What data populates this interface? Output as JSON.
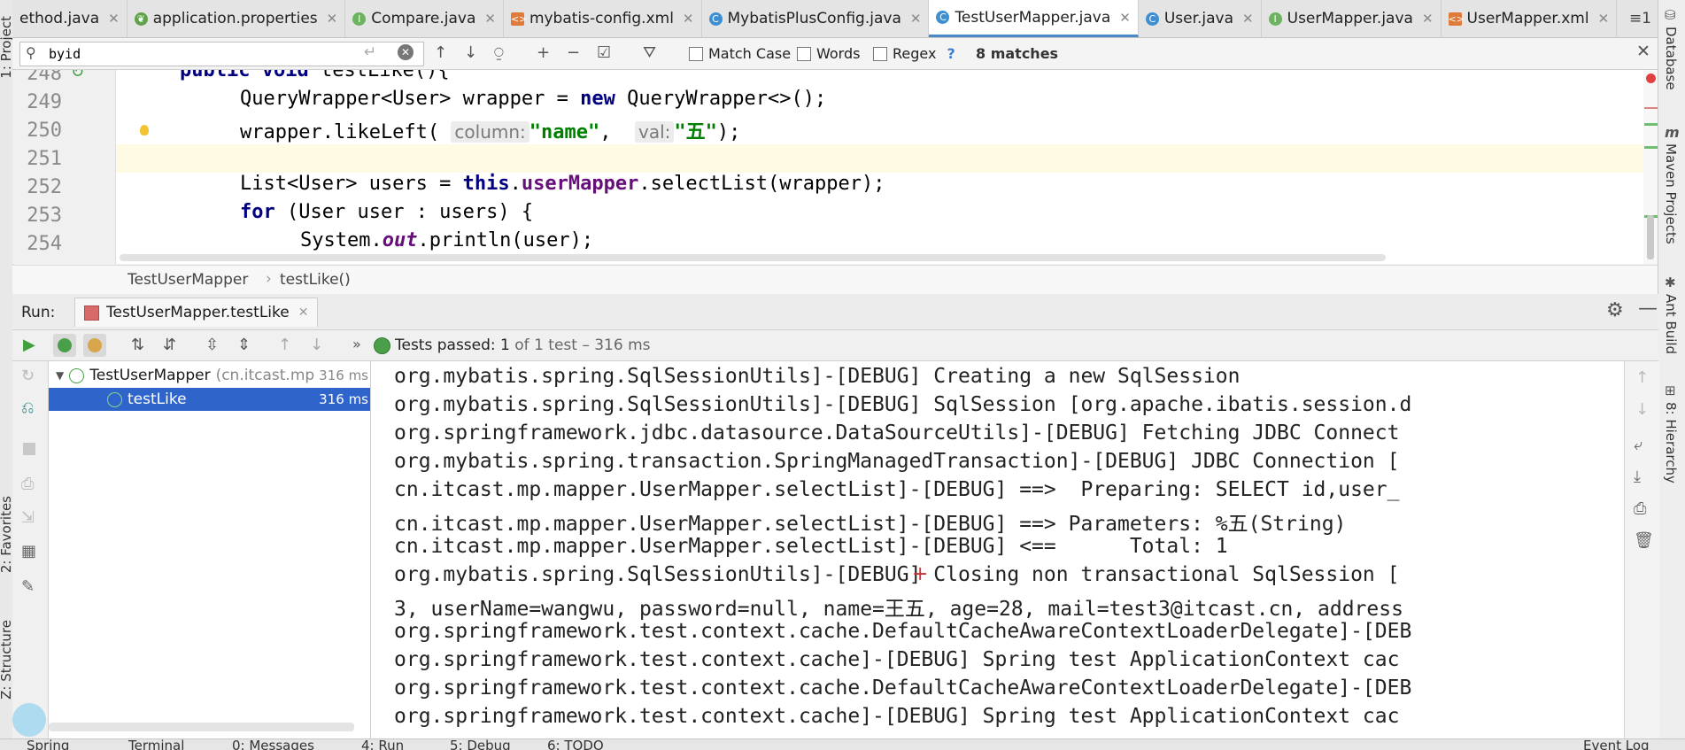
{
  "tabs": [
    {
      "label": "ethod.java",
      "icon": "java-class-icon",
      "active": false
    },
    {
      "label": "application.properties",
      "icon": "spring-leaf-icon",
      "active": false
    },
    {
      "label": "Compare.java",
      "icon": "interface-icon",
      "active": false
    },
    {
      "label": "mybatis-config.xml",
      "icon": "xml-file-icon",
      "active": false
    },
    {
      "label": "MybatisPlusConfig.java",
      "icon": "java-class-icon",
      "active": false
    },
    {
      "label": "TestUserMapper.java",
      "icon": "java-class-icon",
      "active": true
    },
    {
      "label": "User.java",
      "icon": "java-class-icon",
      "active": false
    },
    {
      "label": "UserMapper.java",
      "icon": "interface-icon",
      "active": false
    },
    {
      "label": "UserMapper.xml",
      "icon": "xml-file-icon",
      "active": false
    }
  ],
  "tab_overflow": "≡1",
  "find": {
    "query": "byid",
    "match_case": "Match Case",
    "words": "Words",
    "regex": "Regex",
    "help": "?",
    "matches": "8 matches"
  },
  "editor": {
    "line_numbers": [
      "248",
      "249",
      "250",
      "251",
      "252",
      "253",
      "254"
    ],
    "l248": {
      "a": "public",
      "b": " ",
      "c": "void",
      "d": " testLike(){"
    },
    "l249": {
      "a": "QueryWrapper<User> wrapper = ",
      "b": "new",
      "c": " QueryWrapper<>();"
    },
    "l250": {
      "a": "wrapper.likeLeft( ",
      "hint1": "column:",
      "s1": "\"name\"",
      "c": ",  ",
      "hint2": "val:",
      "s2": "\"五\"",
      "d": ");"
    },
    "l252": {
      "a": "List<User> users = ",
      "b": "this",
      "c": ".",
      "d": "userMapper",
      "e": ".selectList(wrapper);"
    },
    "l253": {
      "a": "for",
      "b": " (User user : users) {"
    },
    "l254": {
      "a": "System.",
      "b": "out",
      "c": ".println(user);"
    }
  },
  "breadcrumb": {
    "class": "TestUserMapper",
    "method": "testLike()"
  },
  "run": {
    "label": "Run:",
    "tab": "TestUserMapper.testLike",
    "status_prefix": "Tests passed:",
    "status_count": "1",
    "status_rest": "of 1 test – 316 ms"
  },
  "tree": [
    {
      "name": "TestUserMapper",
      "pkg": "(cn.itcast.mp",
      "time": "316 ms"
    },
    {
      "name": "testLike",
      "time": "316 ms"
    }
  ],
  "console": [
    "org.mybatis.spring.SqlSessionUtils]-[DEBUG] Creating a new SqlSession",
    "org.mybatis.spring.SqlSessionUtils]-[DEBUG] SqlSession [org.apache.ibatis.session.d",
    "org.springframework.jdbc.datasource.DataSourceUtils]-[DEBUG] Fetching JDBC Connect",
    "org.mybatis.spring.transaction.SpringManagedTransaction]-[DEBUG] JDBC Connection [",
    "cn.itcast.mp.mapper.UserMapper.selectList]-[DEBUG] ==>  Preparing: SELECT id,user_",
    "cn.itcast.mp.mapper.UserMapper.selectList]-[DEBUG] ==> Parameters: %五(String)",
    "cn.itcast.mp.mapper.UserMapper.selectList]-[DEBUG] <==      Total: 1",
    "org.mybatis.spring.SqlSessionUtils]-[DEBUG] Closing non transactional SqlSession [",
    "3, userName=wangwu, password=null, name=王五, age=28, mail=test3@itcast.cn, address",
    "org.springframework.test.context.cache.DefaultCacheAwareContextLoaderDelegate]-[DEB",
    "org.springframework.test.context.cache]-[DEBUG] Spring test ApplicationContext cac",
    "org.springframework.test.context.cache.DefaultCacheAwareContextLoaderDelegate]-[DEB",
    "org.springframework.test.context.cache]-[DEBUG] Spring test ApplicationContext cac"
  ],
  "left_strip": [
    "1: Project",
    "2: Favorites",
    "Z: Structure"
  ],
  "right_strip": [
    "Database",
    "Maven Projects",
    "Ant Build",
    "8: Hierarchy"
  ],
  "bottom_tabs": [
    "Spring",
    "Terminal",
    "0: Messages",
    "4: Run",
    "5: Debug",
    "6: TODO",
    "Event Log"
  ]
}
